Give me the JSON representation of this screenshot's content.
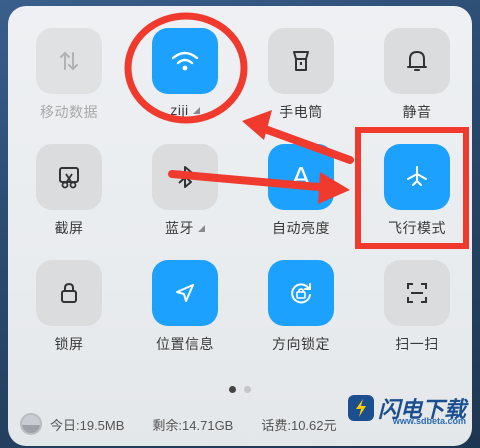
{
  "toggles": [
    {
      "label": "移动数据",
      "icon": "mobile-data-icon",
      "state": "off"
    },
    {
      "label": "ziji",
      "icon": "wifi-icon",
      "state": "on"
    },
    {
      "label": "手电筒",
      "icon": "flashlight-icon",
      "state": "off"
    },
    {
      "label": "静音",
      "icon": "bell-icon",
      "state": "off"
    },
    {
      "label": "截屏",
      "icon": "screenshot-icon",
      "state": "off"
    },
    {
      "label": "蓝牙",
      "icon": "bluetooth-icon",
      "state": "off"
    },
    {
      "label": "自动亮度",
      "icon": "auto-brightness-icon",
      "state": "on"
    },
    {
      "label": "飞行模式",
      "icon": "airplane-icon",
      "state": "on"
    },
    {
      "label": "锁屏",
      "icon": "lock-icon",
      "state": "off"
    },
    {
      "label": "位置信息",
      "icon": "location-icon",
      "state": "on"
    },
    {
      "label": "方向锁定",
      "icon": "rotation-lock-icon",
      "state": "on"
    },
    {
      "label": "扫一扫",
      "icon": "scan-icon",
      "state": "off"
    }
  ],
  "auto_brightness_glyph": "A",
  "storage": {
    "today": "今日:19.5MB",
    "remaining": "剩余:14.71GB",
    "balance": "话费:10.62元"
  },
  "pager": {
    "pages": 2,
    "current": 1
  },
  "watermark": {
    "brand": "闪电下载",
    "url": "www.sdbeta.com"
  },
  "colors": {
    "accent": "#1da1ff",
    "annotation": "#f03a2e"
  }
}
